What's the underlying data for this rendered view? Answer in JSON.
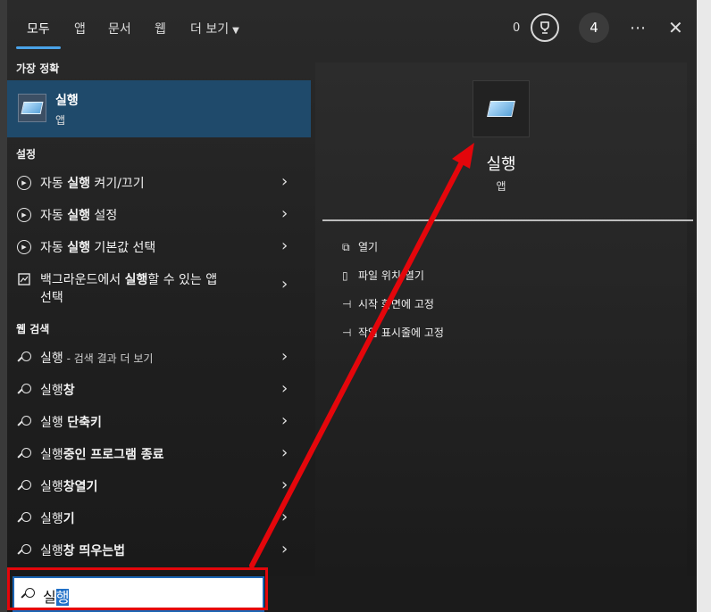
{
  "tabs": [
    "모두",
    "앱",
    "문서",
    "웹",
    "더 보기"
  ],
  "header": {
    "rewards_count": "0",
    "account_initial": "4",
    "more": "⋯",
    "close": "✕"
  },
  "best_match": {
    "section": "가장 정확",
    "name": "실행",
    "type": "앱"
  },
  "settings": {
    "section": "설정",
    "items": [
      {
        "pre": "자동 ",
        "bold": "실행",
        "post": " 켜기/끄기"
      },
      {
        "pre": "자동 ",
        "bold": "실행",
        "post": " 설정"
      },
      {
        "pre": "자동 ",
        "bold": "실행",
        "post": " 기본값 선택"
      },
      {
        "pre": "백그라운드에서 ",
        "bold": "실행",
        "post": "할 수 있는 앱",
        "line2": "선택"
      }
    ]
  },
  "web": {
    "section": "웹 검색",
    "items": [
      {
        "pre": "실행",
        "bold": "",
        "hint": " - 검색 결과 더 보기"
      },
      {
        "pre": "실행",
        "bold": "창",
        "hint": ""
      },
      {
        "pre": "실행 ",
        "bold": "단축키",
        "hint": ""
      },
      {
        "pre": "실행",
        "bold": "중인 프로그램 종료",
        "hint": ""
      },
      {
        "pre": "실행",
        "bold": "창열기",
        "hint": ""
      },
      {
        "pre": "실행",
        "bold": "기",
        "hint": ""
      },
      {
        "pre": "실행",
        "bold": "창 띄우는법",
        "hint": ""
      }
    ]
  },
  "preview": {
    "name": "실행",
    "type": "앱",
    "actions": [
      "열기",
      "파일 위치 열기",
      "시작 화면에 고정",
      "작업 표시줄에 고정"
    ]
  },
  "search": {
    "typed": "실",
    "selected": "행"
  },
  "colors": {
    "accent": "#4aa3e8",
    "best_bg": "#1f4a6b",
    "annotation": "#e4060b"
  }
}
